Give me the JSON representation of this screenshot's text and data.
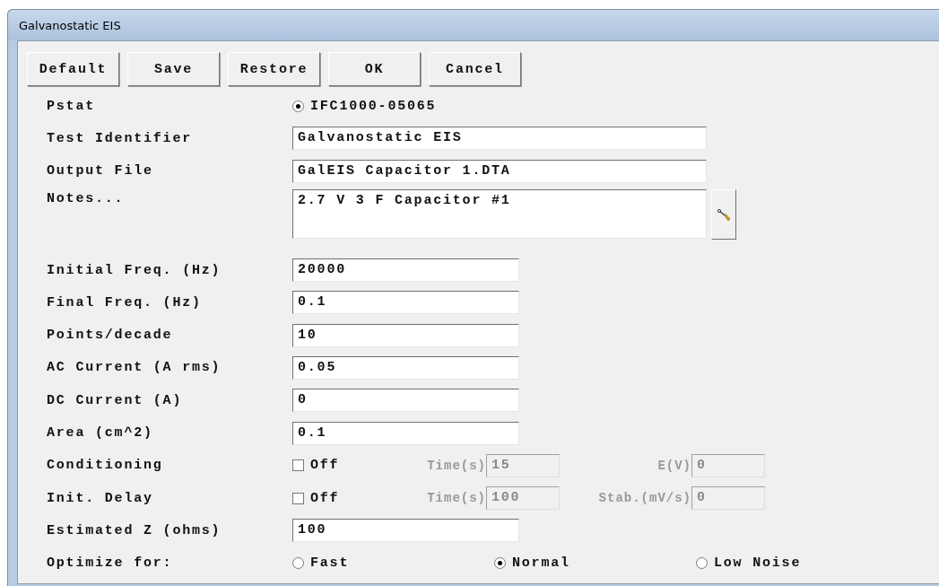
{
  "window": {
    "title": "Galvanostatic EIS"
  },
  "buttons": [
    "Default",
    "Save",
    "Restore",
    "OK",
    "Cancel"
  ],
  "rows": [
    {
      "kind": "radio",
      "label": "Pstat",
      "options": [
        {
          "label": "IFC1000-05065",
          "selected": true
        }
      ]
    },
    {
      "kind": "long_text",
      "label": "Test Identifier",
      "value": "Galvanostatic EIS"
    },
    {
      "kind": "long_text",
      "label": "Output File",
      "value": "GalEIS Capacitor 1.DTA"
    },
    {
      "kind": "notes",
      "label": "Notes...",
      "value": "2.7 V 3 F Capacitor  #1"
    },
    {
      "kind": "text",
      "label": "Initial Freq. (Hz)",
      "value": "20000"
    },
    {
      "kind": "text",
      "label": "Final Freq. (Hz)",
      "value": "0.1"
    },
    {
      "kind": "text",
      "label": "Points/decade",
      "value": "10"
    },
    {
      "kind": "text",
      "label": "AC Current (A rms)",
      "value": "0.05"
    },
    {
      "kind": "text",
      "label": "DC Current (A)",
      "value": "0"
    },
    {
      "kind": "text",
      "label": "Area (cm^2)",
      "value": "0.1"
    },
    {
      "kind": "check",
      "label": "Conditioning",
      "checked": false,
      "check_label": "Off",
      "subfields": [
        {
          "label": "Time(s)",
          "value": "15",
          "disabled": true
        },
        {
          "label": "E(V)",
          "value": "0",
          "disabled": true
        }
      ]
    },
    {
      "kind": "check",
      "label": "Init. Delay",
      "checked": false,
      "check_label": "Off",
      "subfields": [
        {
          "label": "Time(s)",
          "value": "100",
          "disabled": true
        },
        {
          "label": "Stab.(mV/s)",
          "value": "0",
          "disabled": true
        }
      ]
    },
    {
      "kind": "text",
      "label": "Estimated Z (ohms)",
      "value": "100"
    },
    {
      "kind": "radio",
      "label": "Optimize for:",
      "options": [
        {
          "label": "Fast",
          "selected": false
        },
        {
          "label": "Normal",
          "selected": true
        },
        {
          "label": "Low Noise",
          "selected": false
        }
      ]
    }
  ]
}
